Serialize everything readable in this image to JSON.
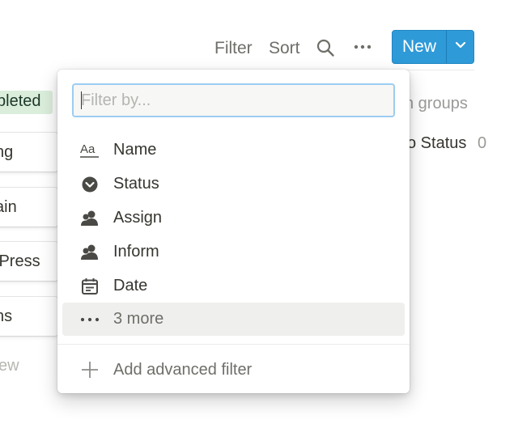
{
  "toolbar": {
    "filter_label": "Filter",
    "sort_label": "Sort",
    "search_icon": "search-icon",
    "more_icon": "more-horizontal-icon",
    "new_label": "New",
    "new_dropdown_icon": "chevron-down-icon",
    "accent_color": "#2f9ad8"
  },
  "board": {
    "status_tag": "pleted",
    "status_tag_color": "#dbeddb",
    "cards": [
      "ng",
      "ain",
      "lPress",
      "ns"
    ],
    "new_link": "ew",
    "hidden_groups_label": "n groups",
    "no_status_label": "o Status",
    "no_status_count": "0"
  },
  "filter_popup": {
    "search_placeholder": "Filter by...",
    "search_value": "",
    "options": [
      {
        "label": "Name",
        "icon": "text-property-icon"
      },
      {
        "label": "Status",
        "icon": "status-property-icon"
      },
      {
        "label": "Assign",
        "icon": "person-property-icon"
      },
      {
        "label": "Inform",
        "icon": "person-property-icon"
      },
      {
        "label": "Date",
        "icon": "calendar-property-icon"
      },
      {
        "label": "3 more",
        "icon": "more-horizontal-icon"
      }
    ],
    "add_advanced_label": "Add advanced filter",
    "add_icon": "plus-icon"
  }
}
